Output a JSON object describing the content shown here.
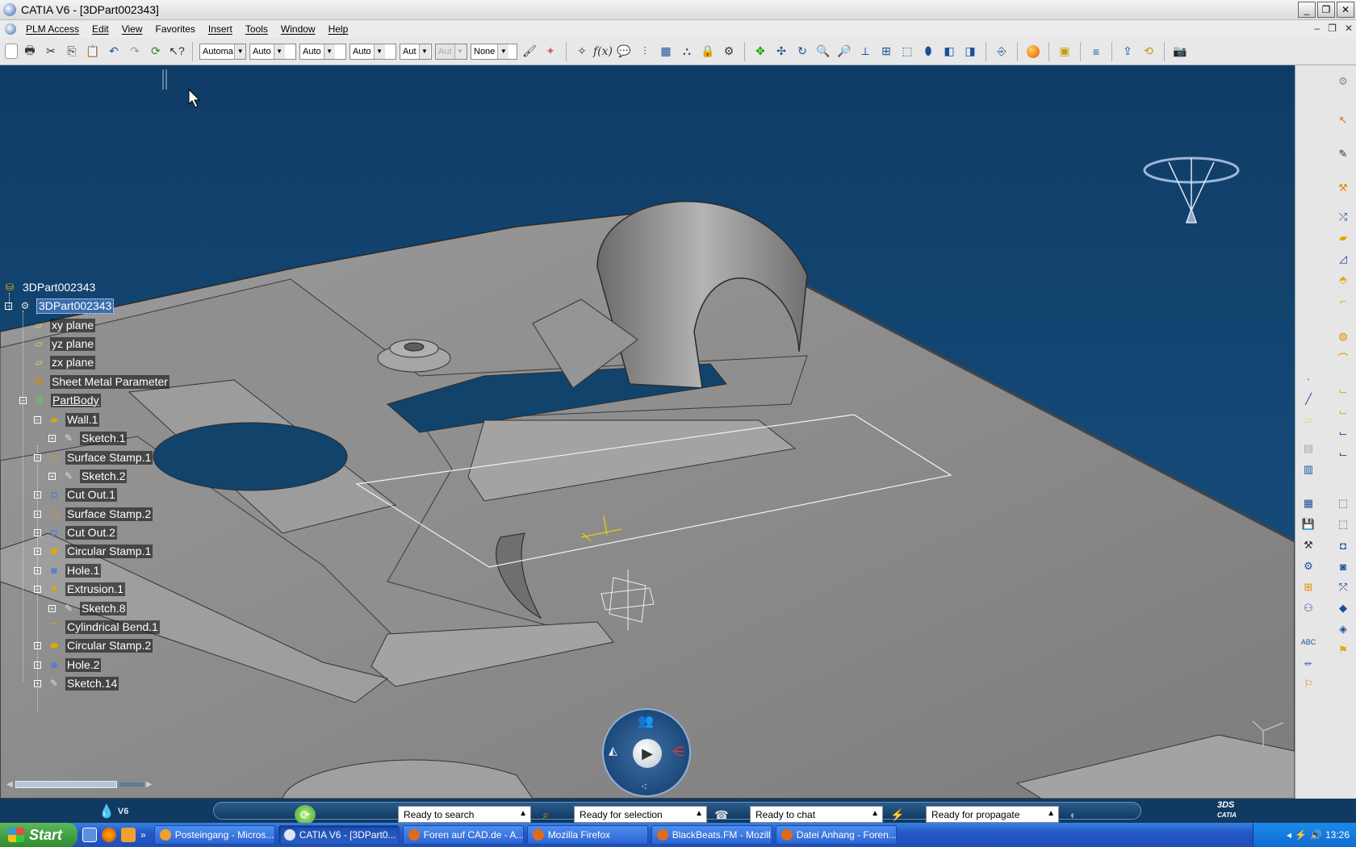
{
  "window": {
    "title": "CATIA V6 - [3DPart002343]",
    "minimize": "_",
    "restore": "❐",
    "close": "✕"
  },
  "menubar": {
    "items": [
      "PLM Access",
      "Edit",
      "View",
      "Favorites",
      "Insert",
      "Tools",
      "Window",
      "Help"
    ]
  },
  "toolbar": {
    "combos": [
      {
        "value": "Automa",
        "disabled": false
      },
      {
        "value": "Auto",
        "disabled": false
      },
      {
        "value": "Auto",
        "disabled": false
      },
      {
        "value": "Auto",
        "disabled": false
      },
      {
        "value": "Aut",
        "disabled": false
      },
      {
        "value": "Aut",
        "disabled": true
      },
      {
        "value": "None",
        "disabled": false
      }
    ]
  },
  "tree": {
    "root": "3DPart002343",
    "part": "3DPart002343",
    "items": [
      {
        "label": "xy plane",
        "icon": "plane-icon"
      },
      {
        "label": "yz plane",
        "icon": "plane-icon"
      },
      {
        "label": "zx plane",
        "icon": "plane-icon"
      },
      {
        "label": "Sheet Metal Parameter",
        "icon": "sheet-metal-parameters-icon"
      },
      {
        "label": "PartBody",
        "icon": "partbody-icon"
      },
      {
        "label": "Wall.1",
        "icon": "wall-icon"
      },
      {
        "label": "Sketch.1",
        "icon": "sketch-icon"
      },
      {
        "label": "Surface Stamp.1",
        "icon": "surface-stamp-icon"
      },
      {
        "label": "Sketch.2",
        "icon": "sketch-icon"
      },
      {
        "label": "Cut Out.1",
        "icon": "cut-out-icon"
      },
      {
        "label": "Surface Stamp.2",
        "icon": "surface-stamp-icon"
      },
      {
        "label": "Cut Out.2",
        "icon": "cut-out-icon"
      },
      {
        "label": "Circular Stamp.1",
        "icon": "circular-stamp-icon"
      },
      {
        "label": "Hole.1",
        "icon": "hole-icon"
      },
      {
        "label": "Extrusion.1",
        "icon": "extrusion-icon"
      },
      {
        "label": "Sketch.8",
        "icon": "sketch-icon"
      },
      {
        "label": "Cylindrical Bend.1",
        "icon": "cylindrical-bend-icon"
      },
      {
        "label": "Circular Stamp.2",
        "icon": "circular-stamp-icon"
      },
      {
        "label": "Hole.2",
        "icon": "hole-icon"
      },
      {
        "label": "Sketch.14",
        "icon": "sketch-icon"
      }
    ]
  },
  "status": {
    "v6_label": "V6",
    "search": "Ready to search",
    "selection": "Ready for selection",
    "chat": "Ready to chat",
    "propagate": "Ready for propagate",
    "brand": "CATIA"
  },
  "taskbar": {
    "start": "Start",
    "tasks": [
      {
        "label": "Posteingang - Micros...",
        "color": "#f0a030",
        "active": false
      },
      {
        "label": "CATIA V6 - [3DPart0...",
        "color": "#dfe6f0",
        "active": true
      },
      {
        "label": "Foren auf CAD.de - A...",
        "color": "#e06a1c",
        "active": false
      },
      {
        "label": "Mozilla Firefox",
        "color": "#e06a1c",
        "active": false
      },
      {
        "label": "BlackBeats.FM - Mozill...",
        "color": "#e06a1c",
        "active": false
      },
      {
        "label": "Datei Anhang - Foren...",
        "color": "#e06a1c",
        "active": false
      }
    ],
    "clock": "13:26"
  },
  "colors": {
    "viewport_bg": "#12436b",
    "model_gray": "#8d8d8d",
    "tree_text": "#ffffff",
    "selection_blue": "#3a6eae"
  }
}
